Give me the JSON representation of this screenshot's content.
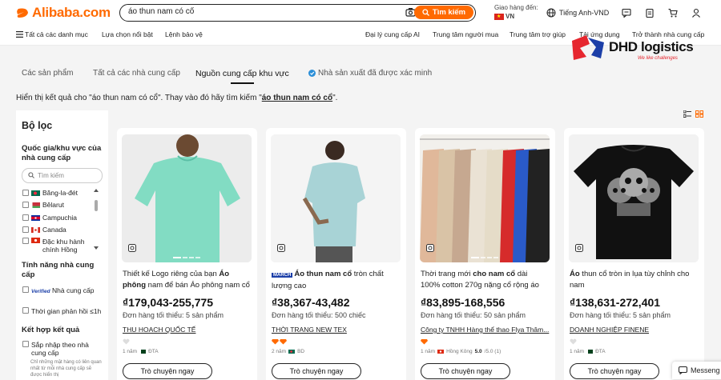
{
  "header": {
    "logo_text": "Alibaba.com",
    "search": {
      "value": "áo thun nam có cổ",
      "button": "Tìm kiếm"
    },
    "ship_label": "Giao hàng đến:",
    "ship_country": "VN",
    "language": "Tiếng Anh-VND",
    "icons": [
      "message-icon",
      "orders-icon",
      "cart-icon",
      "user-icon"
    ]
  },
  "nav": {
    "all_categories": "Tất cả các danh mục",
    "featured": "Lựa chọn nổi bật",
    "protection": "Lệnh bảo vệ",
    "right": [
      "Đại lý cung cấp AI",
      "Trung tâm người mua",
      "Trung tâm trợ giúp",
      "Tải ứng dụng",
      "Trở thành nhà cung cấp"
    ]
  },
  "watermark": {
    "title": "DHD logistics",
    "slogan": "We like challenges"
  },
  "tabs": [
    "Các sản phẩm",
    "Tất cả các nhà cung cấp",
    "Nguồn cung cấp khu vực",
    "Nhà sản xuất đã được xác minh"
  ],
  "notice": {
    "prefix": "Hiển thị kết quả cho \"áo thun nam có cổ\". Thay vào đó hãy tìm kiếm \"",
    "link": "áo thun nam có cổ",
    "suffix": "\"."
  },
  "filter": {
    "title": "Bộ lọc",
    "region_title": "Quốc gia/khu vực của nhà cung cấp",
    "search_placeholder": "Tìm kiếm",
    "countries": [
      "Băng-la-đét",
      "Bêlarut",
      "Campuchia",
      "Canada",
      "Đặc khu hành chính Hồng"
    ],
    "features_title": "Tính năng nhà cung cấp",
    "verified_badge": "Verified",
    "verified_label": "Nhà cung cấp",
    "response_label": "Thời gian phản hồi ≤1h",
    "combine_title": "Kết hợp kết quả",
    "combine_label": "Sắp nhập theo nhà cung cấp",
    "combine_note": "Chỉ những mặt hàng có liên quan nhất từ mỗi nhà cung cấp sẽ được hiển thị"
  },
  "products": [
    {
      "title_pre": "Thiết kế Logo riêng của bạn ",
      "title_bold": "Áo phông",
      "title_post": " nam để bán Áo phông nam cổ tròn Bá...",
      "price": "₫179,043-255,775",
      "moq": "Đơn hàng tối thiểu: 5 sản phẩm",
      "supplier": "THU HOACH QUỐC TẾ",
      "years": "1 năm",
      "country": "ĐTA"
    },
    {
      "badge": "MARCH",
      "title_pre": "",
      "title_bold": "Áo thun nam cổ",
      "title_post": " tròn chất lượng cao",
      "price": "₫38,367-43,482",
      "moq": "Đơn hàng tối thiểu: 500 chiếc",
      "supplier": "THỜI TRANG NEW TEX",
      "years": "2 năm",
      "country": "BD"
    },
    {
      "title_pre": "Thời trang mới ",
      "title_bold": "cho nam cổ",
      "title_post": " dài 100% cotton 270g nặng cổ rộng áo phông...",
      "price": "₫83,895-168,556",
      "moq": "Đơn hàng tối thiểu: 50 sản phẩm",
      "supplier": "Công ty TNHH Hàng thể thao Flya Thâm...",
      "years": "1 năm",
      "country": "Hồng Kông",
      "rating": "5.0",
      "rating_count": "/5.0 (1)"
    },
    {
      "title_pre": "",
      "title_bold": "Áo",
      "title_post": " thun cổ tròn in lụa tùy chỉnh cho nam",
      "price": "₫138,631-272,401",
      "moq": "Đơn hàng tối thiểu: 5 sản phẩm",
      "supplier": "DOANH NGHIỆP FINENE",
      "years": "1 năm",
      "country": "ĐTA"
    }
  ],
  "chat_label": "Trò chuyện ngay",
  "messenger_label": "Messeng"
}
